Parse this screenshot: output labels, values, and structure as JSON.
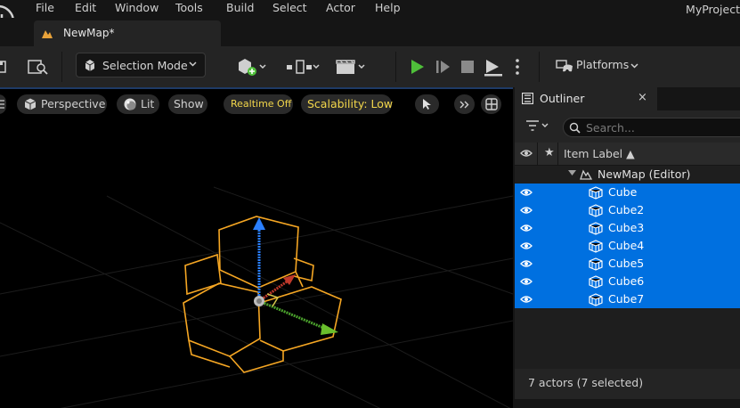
{
  "menu": {
    "items": [
      "File",
      "Edit",
      "Window",
      "Tools",
      "Build",
      "Select",
      "Actor",
      "Help"
    ],
    "project": "MyProject"
  },
  "tab": {
    "label": "NewMap*"
  },
  "toolbar": {
    "mode_label": "Selection Mode",
    "platforms_label": "Platforms",
    "play_color": "#4fbf3a"
  },
  "viewport": {
    "perspective_label": "Perspective",
    "lit_label": "Lit",
    "show_label": "Show",
    "realtime_label": "Realtime Off",
    "scalability_label": "Scalability: Low",
    "selection_color": "#f5a623"
  },
  "outliner": {
    "title": "Outliner",
    "close_glyph": "×",
    "search_placeholder": "Search...",
    "column_star": "★",
    "column_label": "Item Label ▲",
    "root": {
      "label": "NewMap (Editor)"
    },
    "items": [
      {
        "label": "Cube",
        "selected": true
      },
      {
        "label": "Cube2",
        "selected": true
      },
      {
        "label": "Cube3",
        "selected": true
      },
      {
        "label": "Cube4",
        "selected": true
      },
      {
        "label": "Cube5",
        "selected": true
      },
      {
        "label": "Cube6",
        "selected": true
      },
      {
        "label": "Cube7",
        "selected": true
      }
    ],
    "status": "7 actors (7 selected)",
    "selected_color": "#0070e0"
  }
}
